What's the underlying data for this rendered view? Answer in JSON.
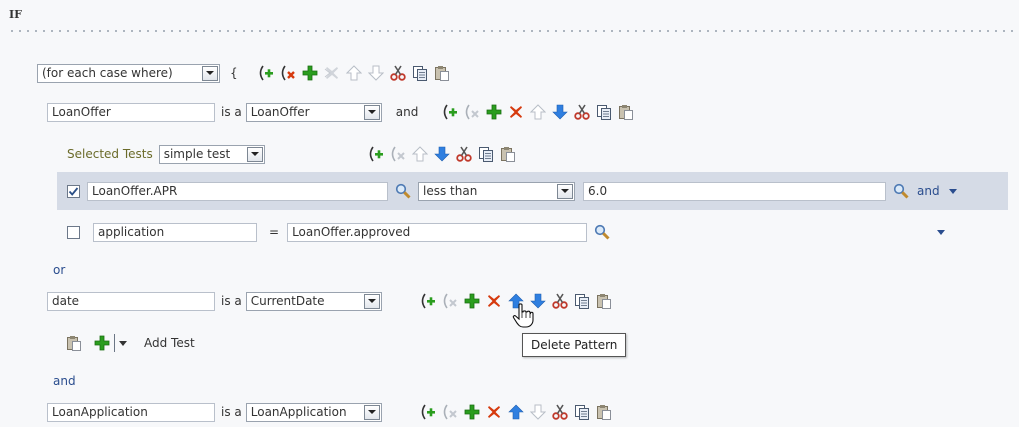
{
  "header": {
    "if_label": "IF"
  },
  "for_each": {
    "selected": "(for each case where)",
    "brace": "{"
  },
  "pattern1": {
    "variable": "LoanOffer",
    "is_a": "is a",
    "type": "LoanOffer",
    "connector": "and"
  },
  "selected_tests": {
    "label": "Selected Tests",
    "value": "simple test"
  },
  "test1": {
    "checked": true,
    "left": "LoanOffer.APR",
    "operator": "less than",
    "right": "6.0",
    "connector": "and"
  },
  "test2": {
    "checked": false,
    "left": "application",
    "operator": "=",
    "right": "LoanOffer.approved"
  },
  "or_label": "or",
  "pattern2": {
    "variable": "date",
    "is_a": "is a",
    "type": "CurrentDate"
  },
  "add_test": {
    "label": "Add Test"
  },
  "and_label": "and",
  "pattern3": {
    "variable": "LoanApplication",
    "is_a": "is a",
    "type": "LoanApplication"
  },
  "tooltip": {
    "text": "Delete Pattern"
  },
  "colors": {
    "add_green": "#2a9d1e",
    "delete_red": "#d63a0e",
    "arrow_blue": "#2f7fe0",
    "disabled_gray": "#b8bec7",
    "highlight_row": "#d5dbe6",
    "link_blue": "#2a4d8e"
  }
}
